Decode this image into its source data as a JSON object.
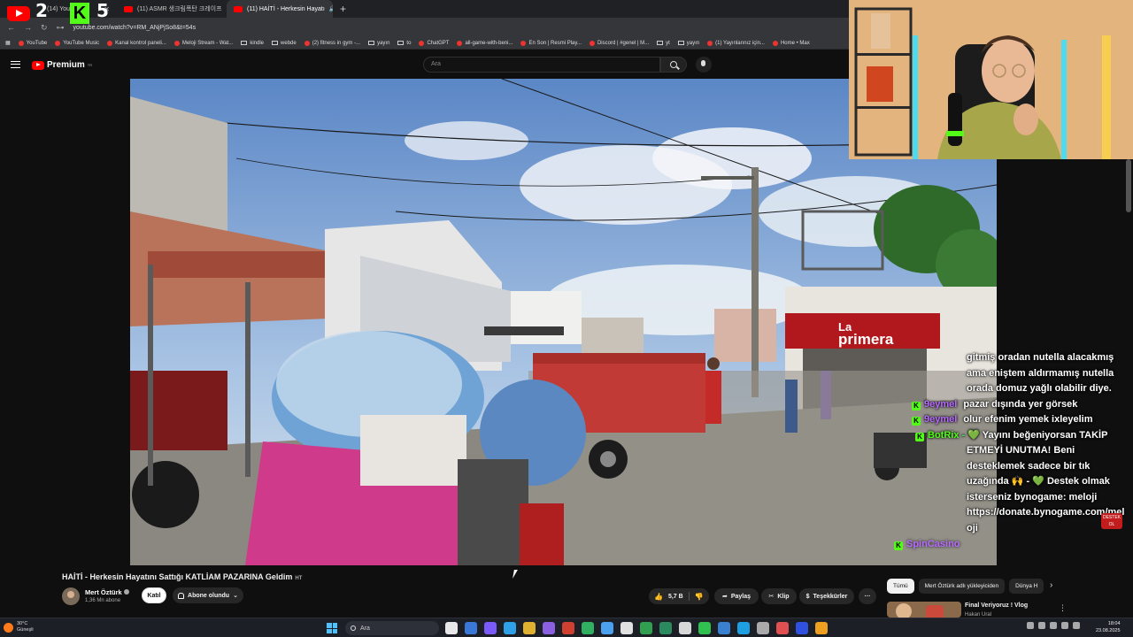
{
  "browser": {
    "tabs": [
      {
        "label": "(14) YouTube",
        "active": false
      },
      {
        "label": "(11) ASMR 생크림폭탄 크레이프",
        "active": false
      },
      {
        "label": "(11) HAİTİ - Herkesin Hayatı",
        "active": true
      }
    ],
    "url": "youtube.com/watch?v=RM_ANjPjSo8&t=54s",
    "bookmarks": [
      "YouTube",
      "YouTube Music",
      "Kanal kontrol paneli...",
      "Meloji Stream - Wat...",
      "kindle",
      "webde",
      "(2) fitness in gym -...",
      "yayın",
      "to",
      "ChatGPT",
      "all-game-with-beni...",
      "En Son | Resmi Play...",
      "Discord | #genel | M...",
      "yt",
      "yayın",
      "(1) Yayınlarınız için...",
      "Home • Max"
    ]
  },
  "overlay": {
    "score_left": "2",
    "score_right": "5",
    "kick_letter": "K"
  },
  "youtube": {
    "logo_text": "Premium",
    "logo_region": "TR",
    "search_placeholder": "Ara"
  },
  "video": {
    "title": "HAİTİ - Herkesin Hayatını Sattığı KATLİAM PAZARINA Geldim",
    "title_tag": "HT",
    "channel": "Mert Öztürk",
    "subscribers": "1,36 Mn abone",
    "join_label": "Katıl",
    "subscribed_label": "Abone olundu",
    "likes": "5,7 B",
    "share_label": "Paylaş",
    "clip_label": "Klip",
    "thanks_label": "Teşekkürler",
    "more_label": "···",
    "shop_sign_1": "La",
    "shop_sign_2": "primera"
  },
  "chat": {
    "message_1": [
      "gitmiş oradan nutella alacakmış",
      "ama eniştem aldırmamış nutella",
      "orada domuz yağlı olabilir diye."
    ],
    "message_2_user": "9eymel",
    "message_2_text": "pazar dışında yer görsek",
    "message_3_user": "9eymel",
    "message_3_text": "olur efenim yemek ixleyelim",
    "message_4_user": "BotRix",
    "message_4_line1": "Yayını beğeniyorsan TAKİP",
    "message_4_lines": [
      "ETMEYİ UNUTMA! Beni",
      "desteklemek sadece bir tık",
      "uzağında 🙌 - 💚 Destek olmak",
      "isterseniz bynogame: meloji",
      "https://donate.bynogame.com/mel",
      "oji"
    ],
    "last_user": "SpinCasino",
    "badge_text": "DESTEK OL"
  },
  "sidebar": {
    "chips": [
      "Tümü",
      "Mert Öztürk adlı yükleyiciden",
      "Dünya H"
    ],
    "rec_title": "Final Veriyoruz ! Vlog",
    "rec_channel": "Hakan Ural"
  },
  "taskbar": {
    "temp": "30°C",
    "condition": "Güneşli",
    "search": "Ara",
    "time": "18:04",
    "date": "23.08.2025",
    "icon_colors": [
      "#e8e8e8",
      "#3a78d8",
      "#7a5af8",
      "#2fa0e8",
      "#e0b030",
      "#8a60e0",
      "#d04030",
      "#30b060",
      "#4ca0f0",
      "#e0e0e0",
      "#30a050",
      "#2b8a5e",
      "#d8d8d8",
      "#30c050",
      "#3a80d0",
      "#1ea0e0",
      "#aaaaaa",
      "#e05050",
      "#3050e0",
      "#f0a020"
    ]
  }
}
